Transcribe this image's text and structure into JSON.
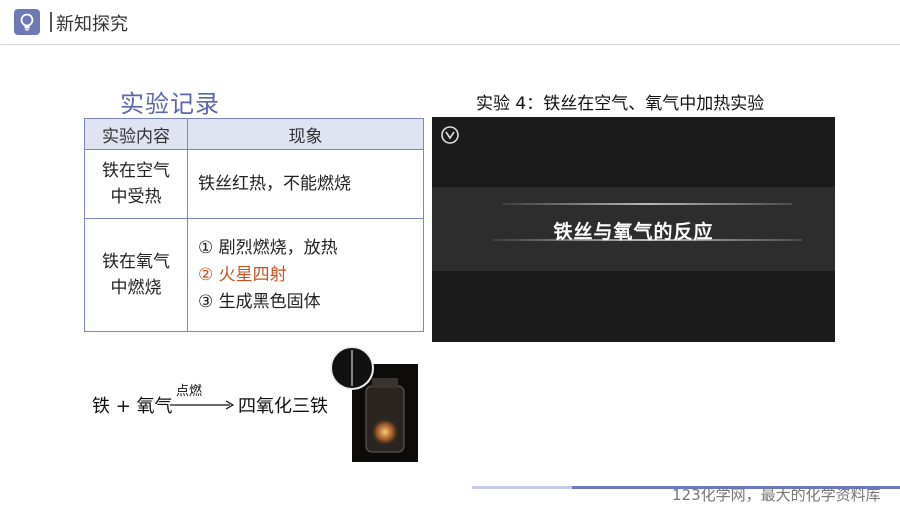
{
  "header": {
    "title": "新知探究",
    "icon": "lightbulb-icon",
    "accent": "#6d78b5"
  },
  "section_title": "实验记录",
  "table": {
    "headers": [
      "实验内容",
      "现象"
    ],
    "rows": [
      {
        "condition_lines": [
          "铁在空气",
          "中受热"
        ],
        "phenomena": [
          "铁丝红热，不能燃烧"
        ]
      },
      {
        "condition_lines": [
          "铁在氧气",
          "中燃烧"
        ],
        "phenomena": [
          "① 剧烈燃烧，放热",
          "② 火星四射",
          "③ 生成黑色固体"
        ],
        "highlight_color": "#c8521e"
      }
    ]
  },
  "video": {
    "title": "实验 4：铁丝在空气、氧气中加热实验",
    "caption": "铁丝与氧气的反应"
  },
  "equation": {
    "left": "铁 + 氧气",
    "condition": "点燃",
    "right": "四氧化三铁"
  },
  "watermark": "123化学网，最大的化学资料库"
}
